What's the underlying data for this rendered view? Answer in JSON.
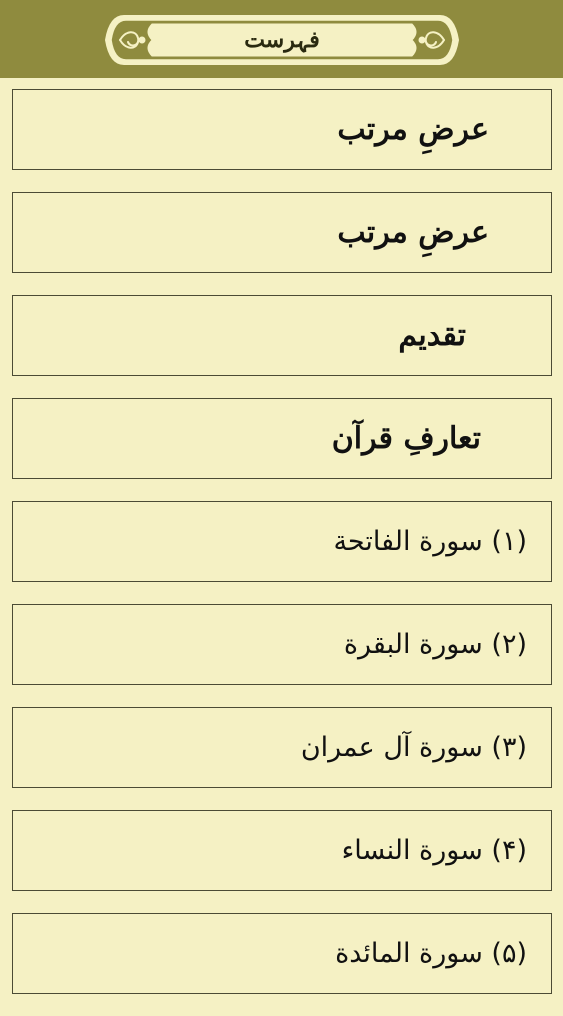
{
  "header": {
    "title": "فہرست"
  },
  "index": {
    "items": [
      {
        "label": "عرضِ مرتب",
        "kind": "heading"
      },
      {
        "label": "عرضِ مرتب",
        "kind": "heading"
      },
      {
        "label": "تقدیم",
        "kind": "heading"
      },
      {
        "label": "تعارفِ قرآن",
        "kind": "heading"
      },
      {
        "label": "(۱) سورة الفاتحة",
        "kind": "surah"
      },
      {
        "label": "(۲) سورة البقرة",
        "kind": "surah"
      },
      {
        "label": "(۳) سورة آل عمران",
        "kind": "surah"
      },
      {
        "label": "(۴) سورة النساء",
        "kind": "surah"
      },
      {
        "label": "(۵) سورة المائدة",
        "kind": "surah"
      }
    ]
  },
  "colors": {
    "header_bg": "#8f8b3e",
    "page_bg": "#f5f1c4",
    "item_border": "#4b4b35"
  }
}
